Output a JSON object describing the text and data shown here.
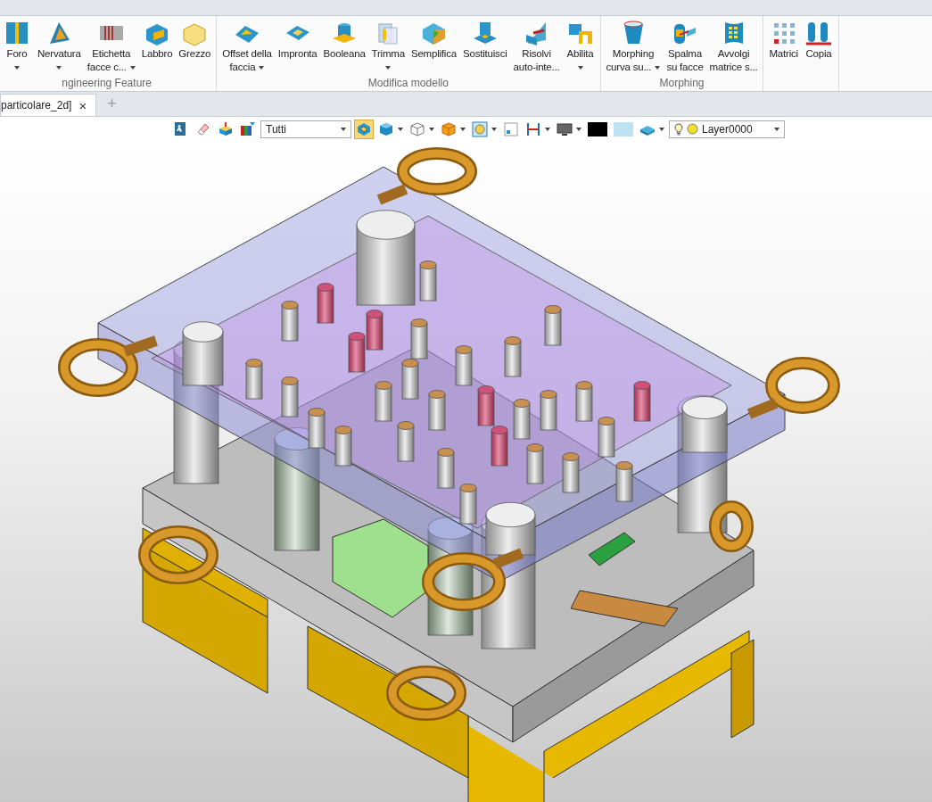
{
  "ribbon": {
    "groups": [
      {
        "label": "ngineering Feature",
        "buttons": [
          {
            "label": [
              "Foro"
            ],
            "kind": "split"
          },
          {
            "label": [
              "Nervatura"
            ],
            "kind": "split"
          },
          {
            "label": [
              "Etichetta",
              "facce c..."
            ],
            "kind": "menu"
          },
          {
            "label": [
              "Labbro"
            ],
            "kind": "plain"
          },
          {
            "label": [
              "Grezzo"
            ],
            "kind": "plain"
          }
        ]
      },
      {
        "label": "Modifica modello",
        "buttons": [
          {
            "label": [
              "Offset della",
              "faccia"
            ],
            "kind": "menu"
          },
          {
            "label": [
              "Impronta"
            ],
            "kind": "plain"
          },
          {
            "label": [
              "Booleana"
            ],
            "kind": "plain"
          },
          {
            "label": [
              "Trimma"
            ],
            "kind": "split"
          },
          {
            "label": [
              "Semplifica"
            ],
            "kind": "plain"
          },
          {
            "label": [
              "Sostituisci"
            ],
            "kind": "plain"
          },
          {
            "label": [
              "Risolvi",
              "auto-inte..."
            ],
            "kind": "plain"
          },
          {
            "label": [
              "Abilita"
            ],
            "kind": "split"
          }
        ]
      },
      {
        "label": "Morphing",
        "buttons": [
          {
            "label": [
              "Morphing",
              "curva su..."
            ],
            "kind": "menu"
          },
          {
            "label": [
              "Spalma",
              "su facce"
            ],
            "kind": "plain"
          },
          {
            "label": [
              "Avvolgi",
              "matrice s..."
            ],
            "kind": "plain"
          }
        ]
      },
      {
        "buttons": [
          {
            "label": [
              "Matrici"
            ],
            "kind": "plain"
          },
          {
            "label": [
              "Copia"
            ],
            "kind": "plain"
          }
        ]
      }
    ]
  },
  "document_tabs": [
    {
      "label": "particolare_2d]",
      "close": "×",
      "selected": true
    }
  ],
  "new_tab": "+",
  "toolbar": {
    "items": [
      {
        "kind": "icon",
        "selected": false,
        "dropdown": false
      },
      {
        "kind": "icon",
        "selected": false,
        "dropdown": false
      },
      {
        "kind": "icon",
        "selected": false,
        "dropdown": false
      },
      {
        "kind": "icon",
        "selected": false,
        "dropdown": false
      },
      {
        "kind": "select",
        "value": "Tutti"
      },
      {
        "kind": "icon",
        "selected": true,
        "dropdown": false
      },
      {
        "kind": "icon",
        "selected": false,
        "dropdown": true
      },
      {
        "kind": "icon",
        "selected": false,
        "dropdown": true
      },
      {
        "kind": "icon",
        "selected": false,
        "dropdown": true
      },
      {
        "kind": "icon",
        "selected": false,
        "dropdown": true
      },
      {
        "kind": "icon",
        "selected": false,
        "dropdown": false
      },
      {
        "kind": "icon",
        "selected": false,
        "dropdown": true
      },
      {
        "kind": "icon",
        "selected": false,
        "dropdown": true
      },
      {
        "kind": "swatch",
        "color": "#000000"
      },
      {
        "kind": "swatch",
        "color": "#bde3f2"
      },
      {
        "kind": "icon",
        "selected": false,
        "dropdown": true
      },
      {
        "kind": "layer",
        "value": "Layer0000"
      }
    ]
  }
}
